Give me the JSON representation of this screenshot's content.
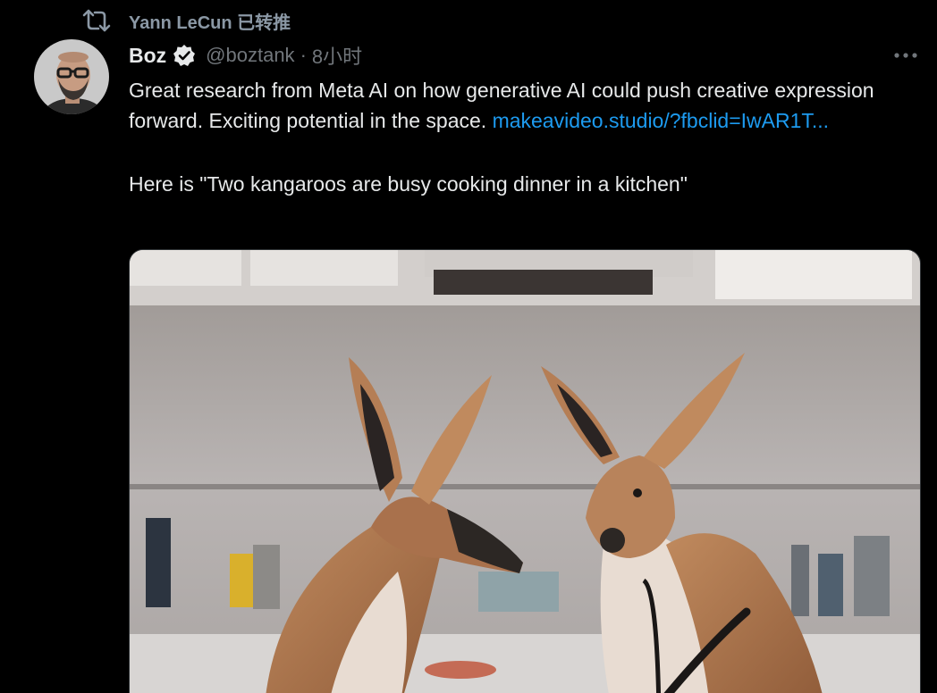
{
  "retweet": {
    "icon": "retweet-icon",
    "retweeter": "Yann LeCun",
    "label": "已转推"
  },
  "author": {
    "display_name": "Boz",
    "verified": true,
    "handle": "@boztank",
    "separator": "·",
    "time": "8小时"
  },
  "tweet": {
    "text_line": "Great research from Meta AI on how generative AI could push creative expression forward. Exciting potential in the space.",
    "link_text": "makeavideo.studio/?fbclid=IwAR1T...",
    "prompt_text": "Here is \"Two kangaroos are busy cooking dinner in a kitchen\""
  },
  "media": {
    "description_icon": "video-thumbnail",
    "content": "two-kangaroos-in-kitchen"
  },
  "colors": {
    "background": "#000000",
    "text_primary": "#e7e9ea",
    "text_secondary": "#71767b",
    "link": "#1d9bf0",
    "verified_badge": "#e7e9ea"
  }
}
